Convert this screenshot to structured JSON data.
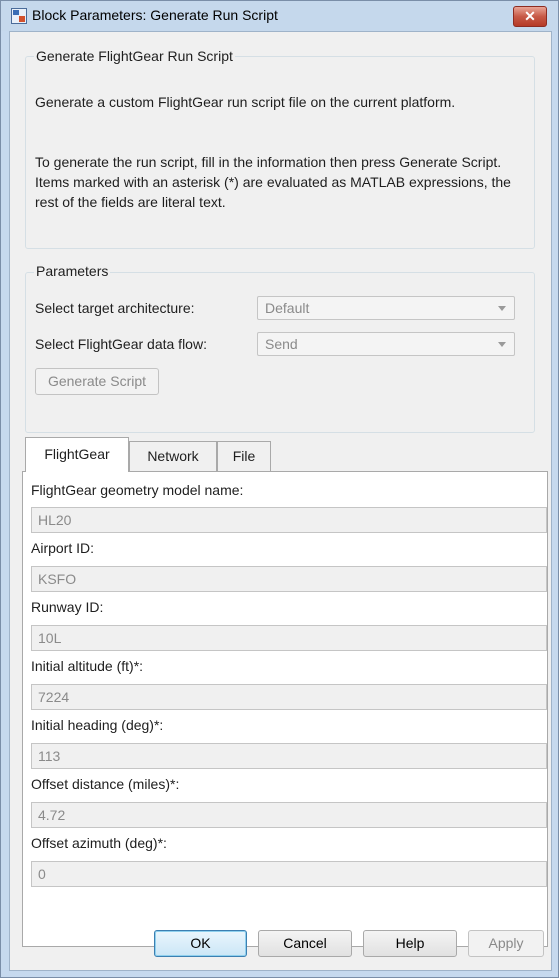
{
  "window": {
    "title": "Block Parameters: Generate Run Script",
    "close_glyph": "✕"
  },
  "description_group": {
    "legend": "Generate FlightGear Run Script",
    "para1": "Generate a custom FlightGear run script file on the current platform.",
    "para2": "To generate the run script, fill in the information then press Generate Script.  Items marked with an asterisk (*) are evaluated as MATLAB expressions, the rest of the fields are literal text."
  },
  "parameters": {
    "legend": "Parameters",
    "architecture_label": "Select target architecture:",
    "architecture_value": "Default",
    "data_flow_label": "Select FlightGear data flow:",
    "data_flow_value": "Send",
    "generate_button": "Generate Script"
  },
  "tabs": [
    {
      "label": "FlightGear",
      "active": true
    },
    {
      "label": "Network",
      "active": false
    },
    {
      "label": "File",
      "active": false
    }
  ],
  "fields": {
    "geometry_model": {
      "label": "FlightGear geometry model name:",
      "value": "HL20"
    },
    "airport_id": {
      "label": "Airport ID:",
      "value": "KSFO"
    },
    "runway_id": {
      "label": "Runway ID:",
      "value": "10L"
    },
    "initial_altitude": {
      "label": "Initial altitude (ft)*:",
      "value": "7224"
    },
    "initial_heading": {
      "label": "Initial heading (deg)*:",
      "value": "113"
    },
    "offset_distance": {
      "label": "Offset distance (miles)*:",
      "value": "4.72"
    },
    "offset_azimuth": {
      "label": "Offset azimuth (deg)*:",
      "value": "0"
    }
  },
  "buttons": {
    "ok": "OK",
    "cancel": "Cancel",
    "help": "Help",
    "apply": "Apply"
  },
  "colors": {
    "titlebar": "#c5d8ec",
    "close_button": "#c75a47",
    "dialog_bg": "#f0f0f0",
    "disabled_text": "#8a8a8a"
  }
}
